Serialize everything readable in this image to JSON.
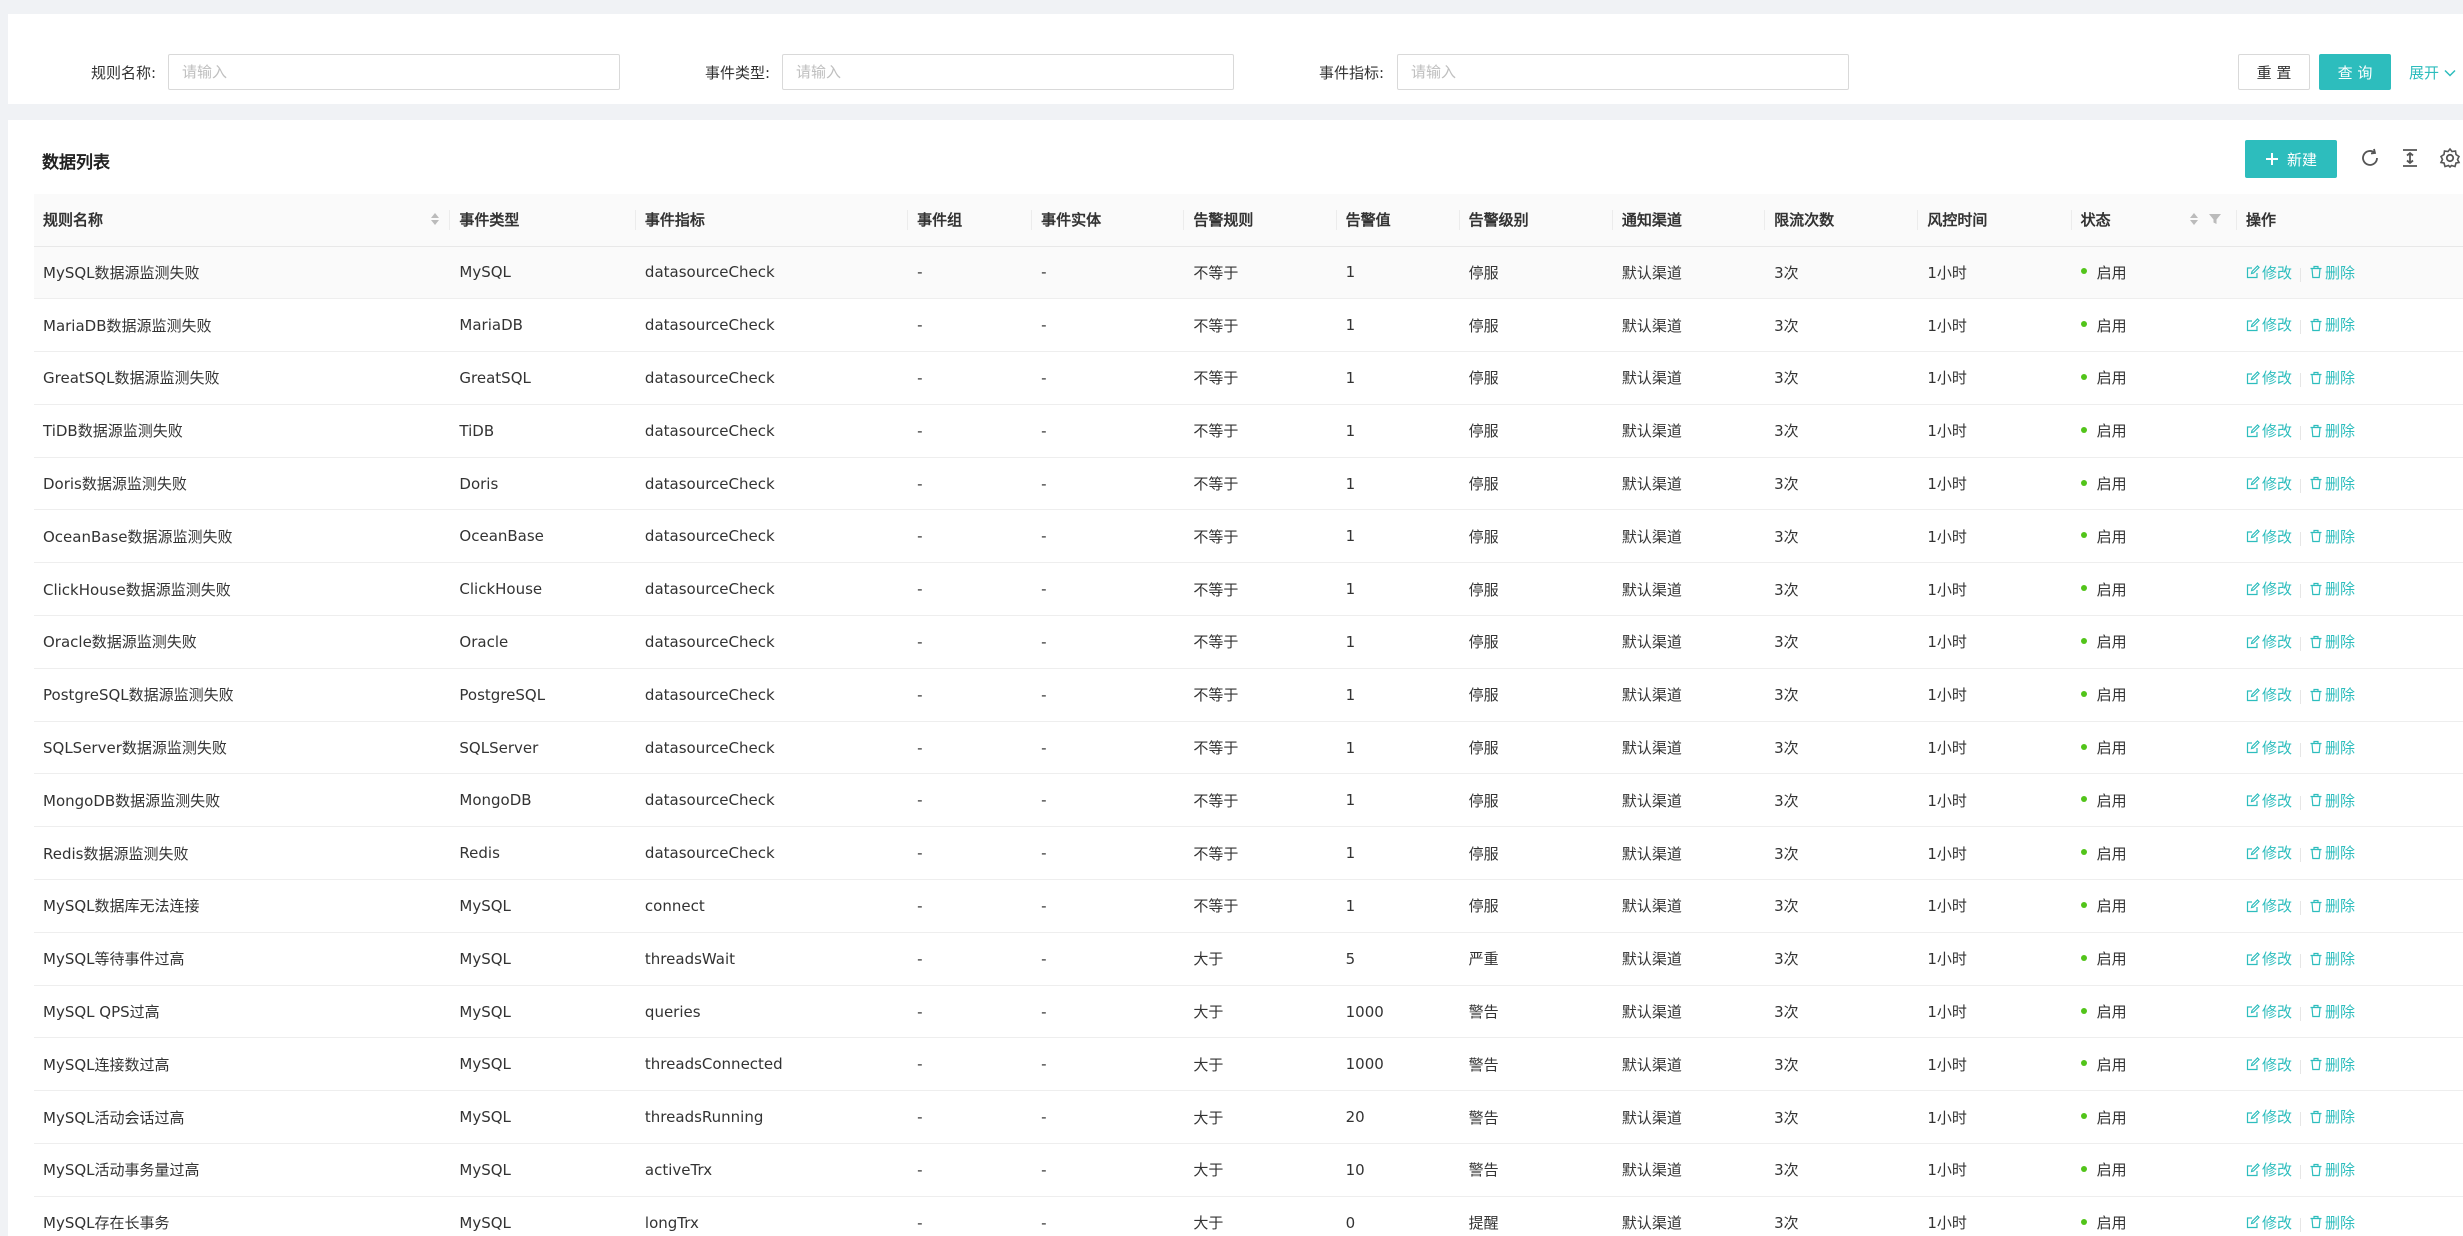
{
  "filters": {
    "rule_name_label": "规则名称:",
    "rule_name_placeholder": "请输入",
    "event_type_label": "事件类型:",
    "event_type_placeholder": "请输入",
    "event_metric_label": "事件指标:",
    "event_metric_placeholder": "请输入",
    "reset_label": "重 置",
    "query_label": "查 询",
    "expand_label": "展开"
  },
  "list": {
    "title": "数据列表",
    "new_label": "新建",
    "columns": [
      "规则名称",
      "事件类型",
      "事件指标",
      "事件组",
      "事件实体",
      "告警规则",
      "告警值",
      "告警级别",
      "通知渠道",
      "限流次数",
      "风控时间",
      "状态",
      "操作"
    ],
    "edit_label": "修改",
    "delete_label": "删除",
    "rows": [
      {
        "name": "MySQL数据源监测失败",
        "type": "MySQL",
        "metric": "datasourceCheck",
        "group": "-",
        "entity": "-",
        "rule": "不等于",
        "value": "1",
        "level": "停服",
        "channel": "默认渠道",
        "limit": "3次",
        "time": "1小时",
        "status": "启用"
      },
      {
        "name": "MariaDB数据源监测失败",
        "type": "MariaDB",
        "metric": "datasourceCheck",
        "group": "-",
        "entity": "-",
        "rule": "不等于",
        "value": "1",
        "level": "停服",
        "channel": "默认渠道",
        "limit": "3次",
        "time": "1小时",
        "status": "启用"
      },
      {
        "name": "GreatSQL数据源监测失败",
        "type": "GreatSQL",
        "metric": "datasourceCheck",
        "group": "-",
        "entity": "-",
        "rule": "不等于",
        "value": "1",
        "level": "停服",
        "channel": "默认渠道",
        "limit": "3次",
        "time": "1小时",
        "status": "启用"
      },
      {
        "name": "TiDB数据源监测失败",
        "type": "TiDB",
        "metric": "datasourceCheck",
        "group": "-",
        "entity": "-",
        "rule": "不等于",
        "value": "1",
        "level": "停服",
        "channel": "默认渠道",
        "limit": "3次",
        "time": "1小时",
        "status": "启用"
      },
      {
        "name": "Doris数据源监测失败",
        "type": "Doris",
        "metric": "datasourceCheck",
        "group": "-",
        "entity": "-",
        "rule": "不等于",
        "value": "1",
        "level": "停服",
        "channel": "默认渠道",
        "limit": "3次",
        "time": "1小时",
        "status": "启用"
      },
      {
        "name": "OceanBase数据源监测失败",
        "type": "OceanBase",
        "metric": "datasourceCheck",
        "group": "-",
        "entity": "-",
        "rule": "不等于",
        "value": "1",
        "level": "停服",
        "channel": "默认渠道",
        "limit": "3次",
        "time": "1小时",
        "status": "启用"
      },
      {
        "name": "ClickHouse数据源监测失败",
        "type": "ClickHouse",
        "metric": "datasourceCheck",
        "group": "-",
        "entity": "-",
        "rule": "不等于",
        "value": "1",
        "level": "停服",
        "channel": "默认渠道",
        "limit": "3次",
        "time": "1小时",
        "status": "启用"
      },
      {
        "name": "Oracle数据源监测失败",
        "type": "Oracle",
        "metric": "datasourceCheck",
        "group": "-",
        "entity": "-",
        "rule": "不等于",
        "value": "1",
        "level": "停服",
        "channel": "默认渠道",
        "limit": "3次",
        "time": "1小时",
        "status": "启用"
      },
      {
        "name": "PostgreSQL数据源监测失败",
        "type": "PostgreSQL",
        "metric": "datasourceCheck",
        "group": "-",
        "entity": "-",
        "rule": "不等于",
        "value": "1",
        "level": "停服",
        "channel": "默认渠道",
        "limit": "3次",
        "time": "1小时",
        "status": "启用"
      },
      {
        "name": "SQLServer数据源监测失败",
        "type": "SQLServer",
        "metric": "datasourceCheck",
        "group": "-",
        "entity": "-",
        "rule": "不等于",
        "value": "1",
        "level": "停服",
        "channel": "默认渠道",
        "limit": "3次",
        "time": "1小时",
        "status": "启用"
      },
      {
        "name": "MongoDB数据源监测失败",
        "type": "MongoDB",
        "metric": "datasourceCheck",
        "group": "-",
        "entity": "-",
        "rule": "不等于",
        "value": "1",
        "level": "停服",
        "channel": "默认渠道",
        "limit": "3次",
        "time": "1小时",
        "status": "启用"
      },
      {
        "name": "Redis数据源监测失败",
        "type": "Redis",
        "metric": "datasourceCheck",
        "group": "-",
        "entity": "-",
        "rule": "不等于",
        "value": "1",
        "level": "停服",
        "channel": "默认渠道",
        "limit": "3次",
        "time": "1小时",
        "status": "启用"
      },
      {
        "name": "MySQL数据库无法连接",
        "type": "MySQL",
        "metric": "connect",
        "group": "-",
        "entity": "-",
        "rule": "不等于",
        "value": "1",
        "level": "停服",
        "channel": "默认渠道",
        "limit": "3次",
        "time": "1小时",
        "status": "启用"
      },
      {
        "name": "MySQL等待事件过高",
        "type": "MySQL",
        "metric": "threadsWait",
        "group": "-",
        "entity": "-",
        "rule": "大于",
        "value": "5",
        "level": "严重",
        "channel": "默认渠道",
        "limit": "3次",
        "time": "1小时",
        "status": "启用"
      },
      {
        "name": "MySQL QPS过高",
        "type": "MySQL",
        "metric": "queries",
        "group": "-",
        "entity": "-",
        "rule": "大于",
        "value": "1000",
        "level": "警告",
        "channel": "默认渠道",
        "limit": "3次",
        "time": "1小时",
        "status": "启用"
      },
      {
        "name": "MySQL连接数过高",
        "type": "MySQL",
        "metric": "threadsConnected",
        "group": "-",
        "entity": "-",
        "rule": "大于",
        "value": "1000",
        "level": "警告",
        "channel": "默认渠道",
        "limit": "3次",
        "time": "1小时",
        "status": "启用"
      },
      {
        "name": "MySQL活动会话过高",
        "type": "MySQL",
        "metric": "threadsRunning",
        "group": "-",
        "entity": "-",
        "rule": "大于",
        "value": "20",
        "level": "警告",
        "channel": "默认渠道",
        "limit": "3次",
        "time": "1小时",
        "status": "启用"
      },
      {
        "name": "MySQL活动事务量过高",
        "type": "MySQL",
        "metric": "activeTrx",
        "group": "-",
        "entity": "-",
        "rule": "大于",
        "value": "10",
        "level": "警告",
        "channel": "默认渠道",
        "limit": "3次",
        "time": "1小时",
        "status": "启用"
      },
      {
        "name": "MySQL存在长事务",
        "type": "MySQL",
        "metric": "longTrx",
        "group": "-",
        "entity": "-",
        "rule": "大于",
        "value": "0",
        "level": "提醒",
        "channel": "默认渠道",
        "limit": "3次",
        "time": "1小时",
        "status": "启用"
      }
    ]
  },
  "colors": {
    "accent": "#2dbdbd",
    "status_enabled": "#52c41a"
  }
}
